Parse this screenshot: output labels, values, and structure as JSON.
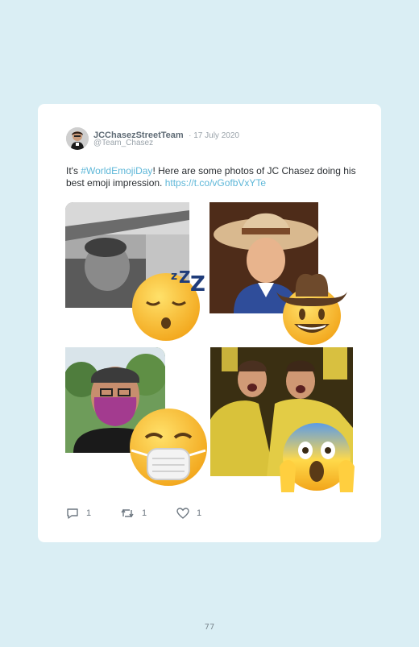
{
  "tweet": {
    "author_name": "JCChasezStreetTeam",
    "date": "· 17 July 2020",
    "handle": "@Team_Chasez",
    "text_prefix": "It's ",
    "hashtag": "#WorldEmojiDay",
    "text_middle": "! Here are some photos of JC Chasez doing his best emoji impression. ",
    "url": "https://t.co/vGofbVxYTe"
  },
  "photos": [
    {
      "emoji": "sleeping-face"
    },
    {
      "emoji": "cowboy-hat-face"
    },
    {
      "emoji": "face-with-medical-mask"
    },
    {
      "emoji": "face-screaming-in-fear"
    }
  ],
  "actions": {
    "reply_count": "1",
    "retweet_count": "1",
    "like_count": "1"
  },
  "colors": {
    "background": "#daeef4",
    "link": "#5eb7d8",
    "card": "#ffffff"
  },
  "page_number": "77"
}
